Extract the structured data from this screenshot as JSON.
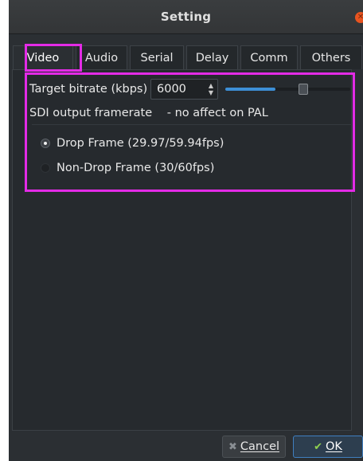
{
  "window": {
    "title": "Setting"
  },
  "tabs": [
    {
      "label": "Video",
      "active": true
    },
    {
      "label": "Audio"
    },
    {
      "label": "Serial"
    },
    {
      "label": "Delay"
    },
    {
      "label": "Comm"
    },
    {
      "label": "Others"
    }
  ],
  "video": {
    "bitrate_label": "Target bitrate (kbps)",
    "bitrate_value": "6000",
    "bitrate_slider_fraction": 0.4,
    "framerate_label": "SDI output framerate",
    "framerate_note": "- no affect on PAL",
    "options": [
      {
        "label": "Drop Frame (29.97/59.94fps)",
        "selected": true
      },
      {
        "label": "Non-Drop Frame (30/60fps)",
        "selected": false
      }
    ]
  },
  "buttons": {
    "cancel_label": "Cancel",
    "ok_label": "OK"
  },
  "colors": {
    "accent": "#3d8fd6",
    "highlight": "#e32be6",
    "close": "#e95420",
    "ok_check": "#8fd14f"
  }
}
